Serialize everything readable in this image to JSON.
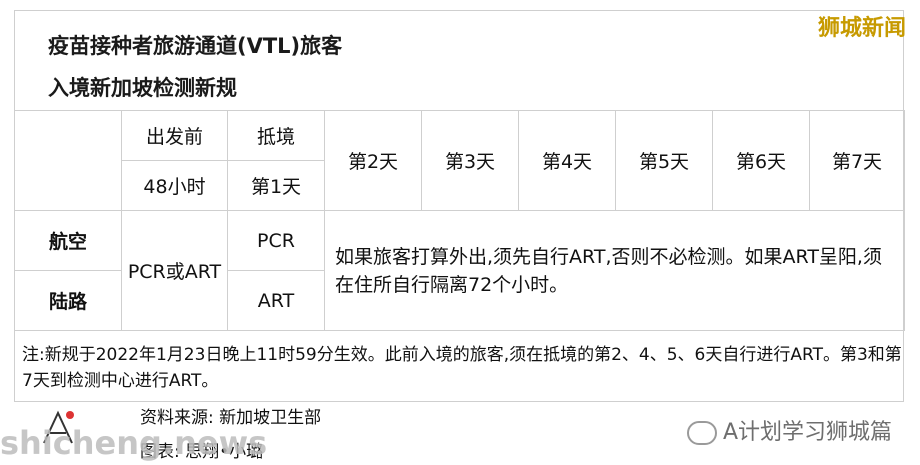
{
  "title_line1": "疫苗接种者旅游通道(VTL)旅客",
  "title_line2": "入境新加坡检测新规",
  "brand": "狮城新闻",
  "table": {
    "header_pre_departure": "出发前",
    "header_pre_departure_time": "48小时",
    "header_arrival": "抵境",
    "header_arrival_day": "第1天",
    "days": [
      "第2天",
      "第3天",
      "第4天",
      "第5天",
      "第6天",
      "第7天"
    ],
    "row_air": "航空",
    "row_land": "陆路",
    "pre_test": "PCR或ART",
    "air_arrival_test": "PCR",
    "land_arrival_test": "ART",
    "instruction": "如果旅客打算外出,须先自行ART,否则不必检测。如果ART呈阳,须在住所自行隔离72个小时。"
  },
  "note": "注:新规于2022年1月23日晚上11时59分生效。此前入境的旅客,须在抵境的第2、4、5、6天自行进行ART。第3和第7天到检测中心进行ART。",
  "source": "资料来源: 新加坡卫生部",
  "chart_credit": "图表: 思翔•小璐",
  "watermark_left": "shicheng.news",
  "watermark_right": "A计划学习狮城篇"
}
